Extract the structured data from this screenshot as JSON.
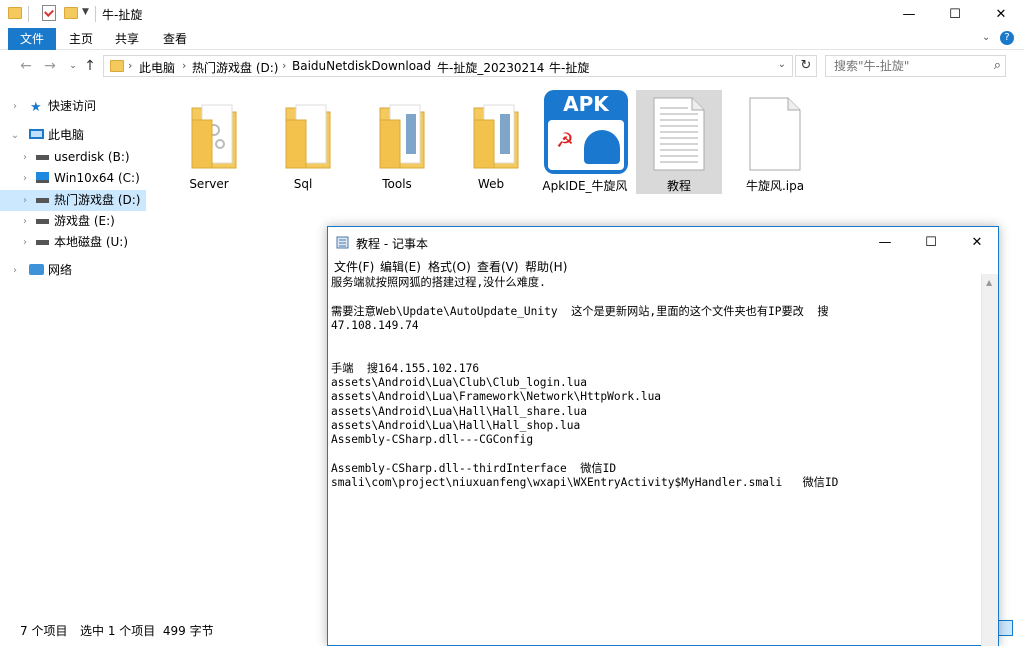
{
  "explorer": {
    "title": "牛-扯旋",
    "window_controls": {
      "minimize": "—",
      "maximize": "☐",
      "close": "✕"
    },
    "ribbon_tabs": [
      "文件",
      "主页",
      "共享",
      "查看"
    ],
    "address": {
      "breadcrumbs": [
        "此电脑",
        "热门游戏盘 (D:)",
        "BaiduNetdiskDownload",
        "牛-扯旋_20230214",
        "牛-扯旋"
      ]
    },
    "search_placeholder": "搜索\"牛-扯旋\"",
    "nav": {
      "quick_access": "快速访问",
      "this_pc": "此电脑",
      "drives": [
        "userdisk (B:)",
        "Win10x64 (C:)",
        "热门游戏盘 (D:)",
        "游戏盘 (E:)",
        "本地磁盘 (U:)"
      ],
      "network": "网络"
    },
    "files": [
      "Server",
      "Sql",
      "Tools",
      "Web",
      "ApkIDE_牛旋风",
      "教程",
      "牛旋风.ipa"
    ],
    "apk_badge": "APK",
    "status": {
      "count": "7 个项目",
      "selection": "选中 1 个项目  499 字节"
    }
  },
  "notepad": {
    "title": "教程 - 记事本",
    "menu": [
      "文件(F)",
      "编辑(E)",
      "格式(O)",
      "查看(V)",
      "帮助(H)"
    ],
    "lines": [
      "服务端就按照网狐的搭建过程,没什么难度.",
      "",
      "需要注意Web\\Update\\AutoUpdate_Unity  这个是更新网站,里面的这个文件夹也有IP要改  搜",
      "47.108.149.74",
      "",
      "",
      "手端  搜164.155.102.176",
      "assets\\Android\\Lua\\Club\\Club_login.lua",
      "assets\\Android\\Lua\\Framework\\Network\\HttpWork.lua",
      "assets\\Android\\Lua\\Hall\\Hall_share.lua",
      "assets\\Android\\Lua\\Hall\\Hall_shop.lua",
      "Assembly-CSharp.dll---CGConfig",
      "",
      "Assembly-CSharp.dll--thirdInterface  微信ID",
      "smali\\com\\project\\niuxuanfeng\\wxapi\\WXEntryActivity$MyHandler.smali   微信ID"
    ]
  },
  "colors": {
    "accent": "#1979ca",
    "selection": "#cce8ff",
    "folder": "#f4c95d"
  }
}
